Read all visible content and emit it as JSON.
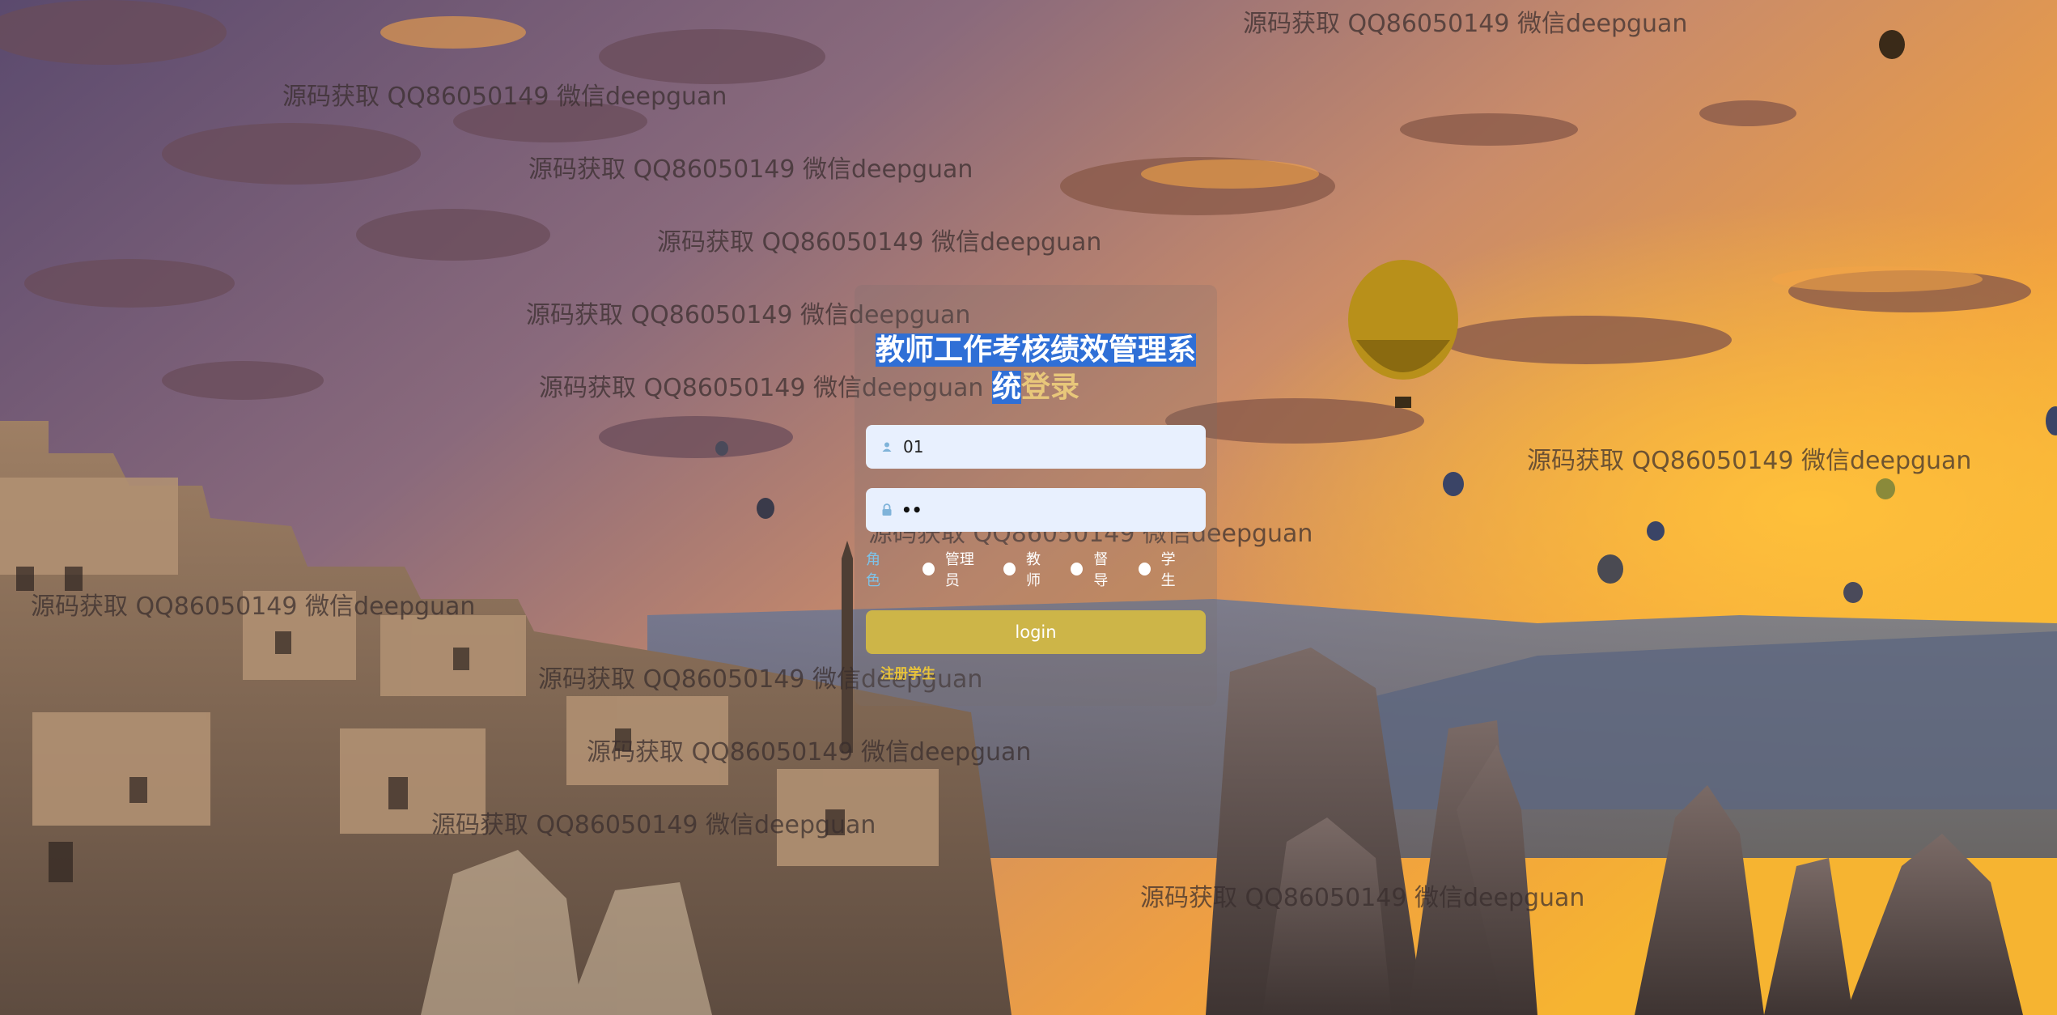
{
  "watermark": "源码获取 QQ86050149 微信deepguan",
  "login": {
    "title_selected_line1": "教师工作考核绩效管理系",
    "title_selected_line2": "统",
    "title_rest": "登录",
    "username_value": "01",
    "password_value": "••",
    "role_label": "角色",
    "roles": [
      "管理员",
      "教师",
      "督导",
      "学生"
    ],
    "login_label": "login",
    "register_label": "注册学生"
  },
  "colors": {
    "panel": "rgba(120,110,110,0.22)",
    "button": "#cdb548",
    "input": "#e8f0fe",
    "title_highlight": "#2f6fd6",
    "register_link": "#e9c43a",
    "role_label": "#7ec2e8"
  },
  "icons": {
    "username": "user-icon",
    "password": "lock-icon"
  }
}
